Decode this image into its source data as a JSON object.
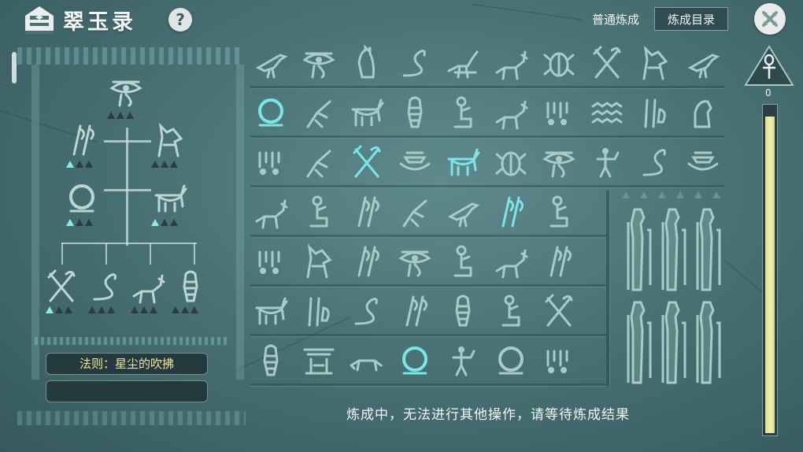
{
  "header": {
    "title": "翠玉录",
    "help_label": "?",
    "tab_normal": "普通炼成",
    "tab_catalog": "炼成目录"
  },
  "left_panel": {
    "rule_text": "法则：星尘的吹拂",
    "second_box_text": "",
    "slots": [
      {
        "glyph": "eye-of-horus",
        "filled": 0,
        "total": 3
      },
      {
        "glyph": "reed-feathers",
        "filled": 1,
        "total": 3
      },
      {
        "glyph": "jackal-head",
        "filled": 0,
        "total": 3
      },
      {
        "glyph": "shen-ring",
        "filled": 1,
        "total": 3
      },
      {
        "glyph": "bull",
        "filled": 1,
        "total": 3
      },
      {
        "glyph": "crook-flail",
        "filled": 1,
        "total": 3
      },
      {
        "glyph": "cobra",
        "filled": 0,
        "total": 3
      },
      {
        "glyph": "jackal",
        "filled": 0,
        "total": 3
      },
      {
        "glyph": "mummy",
        "filled": 0,
        "total": 3
      }
    ]
  },
  "grid": {
    "rows": [
      [
        "bird",
        "eye-of-horus",
        "seated-cat",
        "cobra",
        "ibis",
        "jackal",
        "scarab",
        "crook-flail",
        "jackal-head",
        "bird"
      ],
      [
        "shen-ring",
        "heron",
        "bull",
        "mummy",
        "seated-figure",
        "jackal",
        "vessels",
        "waves",
        "feathers",
        "seated-lion"
      ],
      [
        "vessels",
        "heron",
        "crook-flail",
        "boat",
        "bull",
        "scarab",
        "eye-of-horus",
        "figure",
        "cobra",
        "boat"
      ],
      [
        "jackal",
        "seated-figure",
        "reed-feathers",
        "heron",
        "bird",
        "reed-feathers",
        "seated-figure"
      ],
      [
        "vessels",
        "jackal-head",
        "reed-feathers",
        "eye-of-horus",
        "seated-figure",
        "jackal",
        "reed-feathers"
      ],
      [
        "bull",
        "feathers",
        "cobra",
        "reed-feathers",
        "mummy",
        "seated-figure",
        "crook-flail"
      ],
      [
        "mummy",
        "temple",
        "lion",
        "shen-ring",
        "figure",
        "shen-ring",
        "vessels"
      ]
    ],
    "highlighted": [
      [
        1,
        0
      ],
      [
        2,
        2
      ],
      [
        2,
        4
      ],
      [
        3,
        5
      ],
      [
        6,
        3
      ]
    ],
    "gods": [
      "jackal-god",
      "ibis-god",
      "falcon-god",
      "jackal-god",
      "ibis-god",
      "falcon-god"
    ]
  },
  "status_message": "炼成中，无法进行其他操作，请等待炼成结果",
  "gauge": {
    "label": "0",
    "level": 0.97
  }
}
